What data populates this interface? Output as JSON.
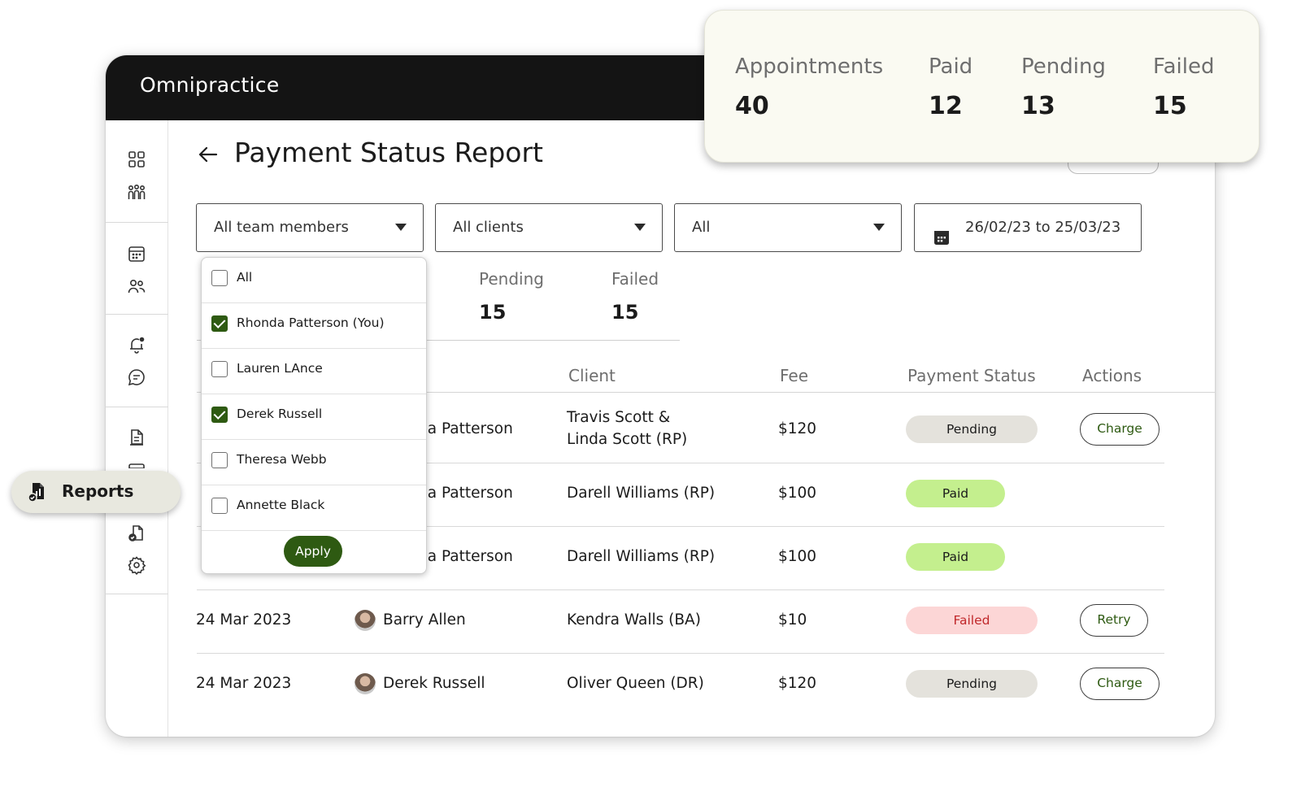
{
  "app": {
    "logo": "Omnipractice"
  },
  "page": {
    "title": "Payment Status Report"
  },
  "filters": {
    "team": "All team members",
    "clients": "All clients",
    "status": "All",
    "date_range": "26/02/23 to 25/03/23"
  },
  "stats_partial": [
    {
      "label": "Pending",
      "value": "15"
    },
    {
      "label": "Failed",
      "value": "15"
    }
  ],
  "table": {
    "headers": {
      "client": "Client",
      "fee": "Fee",
      "status": "Payment Status",
      "actions": "Actions"
    },
    "rows": [
      {
        "date": "",
        "member": "da Patterson",
        "client_line1": "Travis Scott &",
        "client_line2": "Linda Scott (RP)",
        "fee": "$120",
        "status": "Pending",
        "action": "Charge"
      },
      {
        "date": "",
        "member": "da Patterson",
        "client_line1": "Darell Williams (RP)",
        "client_line2": "",
        "fee": "$100",
        "status": "Paid",
        "action": ""
      },
      {
        "date": "",
        "member": "da Patterson",
        "client_line1": "Darell Williams (RP)",
        "client_line2": "",
        "fee": "$100",
        "status": "Paid",
        "action": ""
      },
      {
        "date": "24 Mar 2023",
        "member": "Barry Allen",
        "client_line1": "Kendra Walls (BA)",
        "client_line2": "",
        "fee": "$10",
        "status": "Failed",
        "action": "Retry"
      },
      {
        "date": "24 Mar 2023",
        "member": "Derek Russell",
        "client_line1": "Oliver Queen (DR)",
        "client_line2": "",
        "fee": "$120",
        "status": "Pending",
        "action": "Charge"
      }
    ]
  },
  "dropdown": {
    "items": [
      {
        "label": "All",
        "checked": false
      },
      {
        "label": "Rhonda Patterson (You)",
        "checked": true
      },
      {
        "label": "Lauren LAnce",
        "checked": false
      },
      {
        "label": "Derek Russell",
        "checked": true
      },
      {
        "label": "Theresa Webb",
        "checked": false
      },
      {
        "label": "Annette Black",
        "checked": false
      }
    ],
    "apply_label": "Apply"
  },
  "stats_card": [
    {
      "label": "Appointments",
      "value": "40"
    },
    {
      "label": "Paid",
      "value": "12"
    },
    {
      "label": "Pending",
      "value": "13"
    },
    {
      "label": "Failed",
      "value": "15"
    }
  ],
  "nav_tooltip": {
    "label": "Reports",
    "icon": "report-icon"
  },
  "colors": {
    "accent": "#2e5a12",
    "paid_bg": "#c4ef8e",
    "pending_bg": "#e4e2dc",
    "failed_bg": "#fcd6d6",
    "failed_text": "#c0282b",
    "topbar": "#141414"
  }
}
